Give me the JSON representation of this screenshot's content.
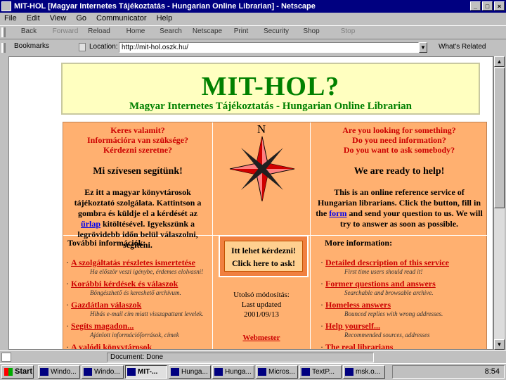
{
  "window": {
    "title": "MIT-HOL [Magyar Internetes Tájékoztatás - Hungarian Online Librarian] - Netscape",
    "minimize": "_",
    "maximize": "□",
    "close": "×"
  },
  "menu": [
    "File",
    "Edit",
    "View",
    "Go",
    "Communicator",
    "Help"
  ],
  "toolbar": [
    "Back",
    "Forward",
    "Reload",
    "Home",
    "Search",
    "Netscape",
    "Print",
    "Security",
    "Shop",
    "Stop"
  ],
  "location": {
    "bookmarks": "Bookmarks",
    "label": "Location:",
    "url": "http://mit-hol.oszk.hu/",
    "related": "What's Related"
  },
  "page": {
    "title": "MIT-HOL?",
    "subtitle": "Magyar Internetes Tájékoztatás - Hungarian Online Librarian",
    "hu_questions": [
      "Keres valamit?",
      "Információra van szüksége?",
      "Kérdezni szeretne?"
    ],
    "hu_help": "Mi szívesen segítünk!",
    "hu_desc_before": "Ez itt a magyar könyvtárosok tájékoztató szolgálata. Kattintson a gombra és küldje el a kérdését az ",
    "hu_desc_link": "űrlap",
    "hu_desc_after": " kitöltésével. Igyekszünk a legrövidebb időn belül válaszolni, segíteni.",
    "compass_n": "N",
    "en_questions": [
      "Are you looking for something?",
      "Do you need information?",
      "Do you want to ask somebody?"
    ],
    "en_help": "We are ready to help!",
    "en_desc_before": "This is an online reference service of Hungarian librarians. Click the button, fill in the ",
    "en_desc_link": "form",
    "en_desc_after": " and send your question to us. We will try to answer as soon as possible.",
    "hu_more": "További információk:",
    "en_more": "More information:",
    "hu_items": [
      {
        "link": "A szolgáltatás részletes ismertetése",
        "desc": "Ha először veszi igénybe, érdemes elolvasni!"
      },
      {
        "link": "Korábbi kérdések és válaszok",
        "desc": "Böngészhető és kereshető archívum."
      },
      {
        "link": "Gazdátlan válaszok",
        "desc": "Hibás e-mail cím miatt visszapattant levelek."
      },
      {
        "link": "Segíts magadon...",
        "desc": "Ajánlott információforrások, címek"
      },
      {
        "link": "A valódi könyvtárosok",
        "desc": ""
      }
    ],
    "en_items": [
      {
        "link": "Detailed description of this service",
        "desc": "First time users should read it!"
      },
      {
        "link": "Former questions and answers",
        "desc": "Searchable and browsable archive."
      },
      {
        "link": "Homeless answers",
        "desc": "Bounced replies with wrong addresses."
      },
      {
        "link": "Help yourself...",
        "desc": "Recommended sources, addresses"
      },
      {
        "link": "The real librarians",
        "desc": ""
      }
    ],
    "ask_hu": "Itt lehet kérdezni!",
    "ask_en": "Click here to ask!",
    "updated_hu": "Utolsó módosítás:",
    "updated_en": "Last updated",
    "updated_date": "2001/09/13",
    "webmaster": "Webmester"
  },
  "status": {
    "text": "Document: Done"
  },
  "taskbar": {
    "start": "Start",
    "tasks": [
      "Windo...",
      "Windo...",
      "MIT-...",
      "Hunga...",
      "Hunga...",
      "Micros...",
      "TextP...",
      "msk.o..."
    ],
    "clock": "8:54"
  },
  "colors": {
    "header_green": "#008000",
    "panel_orange": "#ffb070",
    "link_red": "#cc0000",
    "titlebar_blue": "#000080"
  }
}
